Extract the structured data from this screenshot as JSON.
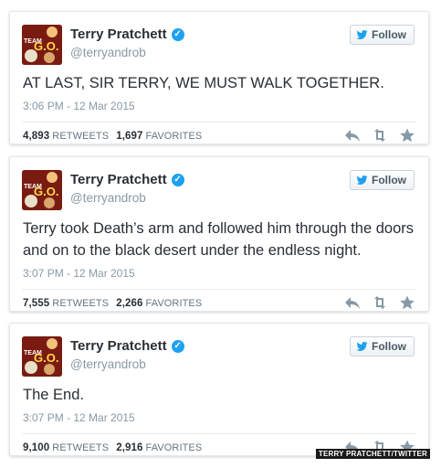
{
  "account": {
    "name": "Terry Pratchett",
    "handle": "@terryandrob",
    "follow_label": "Follow",
    "avatar_text_team": "TEAM",
    "avatar_text_go": "G.O."
  },
  "tweets": [
    {
      "text": "AT LAST, SIR TERRY, WE MUST WALK TOGETHER.",
      "time": "3:06 PM - 12 Mar 2015",
      "retweets": "4,893",
      "retweets_label": "RETWEETS",
      "favorites": "1,697",
      "favorites_label": "FAVORITES"
    },
    {
      "text": "Terry took Death’s arm and followed him through the doors and on to the black desert under the endless night.",
      "time": "3:07 PM - 12 Mar 2015",
      "retweets": "7,555",
      "retweets_label": "RETWEETS",
      "favorites": "2,266",
      "favorites_label": "FAVORITES"
    },
    {
      "text": "The End.",
      "time": "3:07 PM - 12 Mar 2015",
      "retweets": "9,100",
      "retweets_label": "RETWEETS",
      "favorites": "2,916",
      "favorites_label": "FAVORITES"
    }
  ],
  "watermark": "TERRY PRATCHETT/TWITTER",
  "colors": {
    "verified": "#1da1f2",
    "muted_text": "#8899a6",
    "avatar_bg": "#7a1b12"
  }
}
